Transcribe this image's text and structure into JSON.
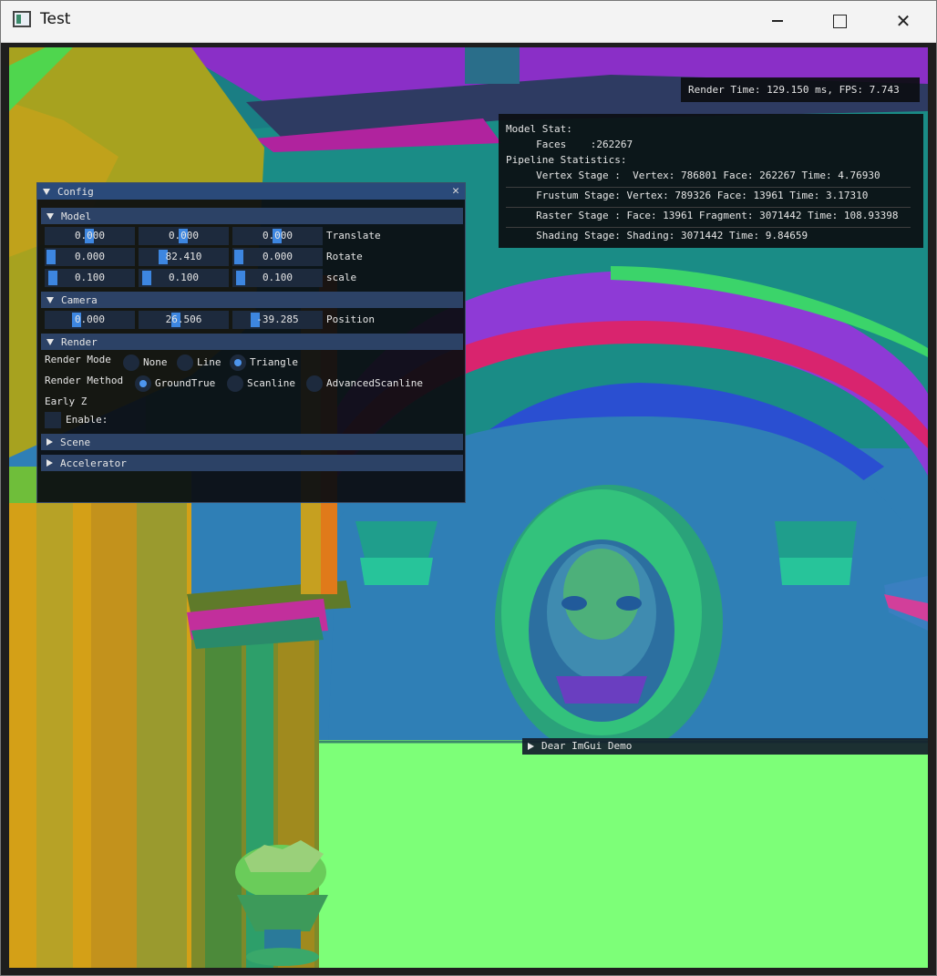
{
  "window": {
    "title": "Test",
    "minimize_glyph": "",
    "close_glyph": "✕"
  },
  "overlay": {
    "render_time": "Render Time: 129.150 ms, FPS: 7.743",
    "model_stat_title": "Model Stat:",
    "faces": "     Faces    :262267",
    "pipeline_title": "Pipeline Statistics:",
    "vertex_stage": "     Vertex Stage :  Vertex: 786801 Face: 262267 Time: 4.76930",
    "frustum_stage": "     Frustum Stage: Vertex: 789326 Face: 13961 Time: 3.17310",
    "raster_stage": "     Raster Stage : Face: 13961 Fragment: 3071442 Time: 108.93398",
    "shading_stage": "     Shading Stage: Shading: 3071442 Time: 9.84659"
  },
  "config": {
    "title": "Config",
    "close_glyph": "✕",
    "model": {
      "header": "Model",
      "translate": {
        "values": [
          "0.000",
          "0.000",
          "0.000"
        ],
        "label": "Translate"
      },
      "rotate": {
        "values": [
          "0.000",
          "82.410",
          "0.000"
        ],
        "label": "Rotate"
      },
      "scale": {
        "values": [
          "0.100",
          "0.100",
          "0.100"
        ],
        "label": "scale"
      }
    },
    "camera": {
      "header": "Camera",
      "position": {
        "values": [
          "0.000",
          "26.506",
          "-39.285"
        ],
        "label": "Position"
      }
    },
    "render": {
      "header": "Render",
      "mode_label": "Render Mode",
      "mode_options": [
        "None",
        "Line",
        "Triangle"
      ],
      "mode_selected": "Triangle",
      "method_label": "Render Method",
      "method_options": [
        "GroundTrue",
        "Scanline",
        "AdvancedScanline"
      ],
      "method_selected": "GroundTrue",
      "early_z_label": "Early Z",
      "enable_label": "Enable:",
      "enable_checked": false
    },
    "scene_header": "Scene",
    "accelerator_header": "Accelerator"
  },
  "demo": {
    "label": "Dear ImGui Demo"
  },
  "colors": {
    "accent": "#3d86e0",
    "header_bg": "#2c4266",
    "title_bg": "#2a4a7a",
    "sky": "#2f7fb6",
    "floor": "#7dff78"
  }
}
